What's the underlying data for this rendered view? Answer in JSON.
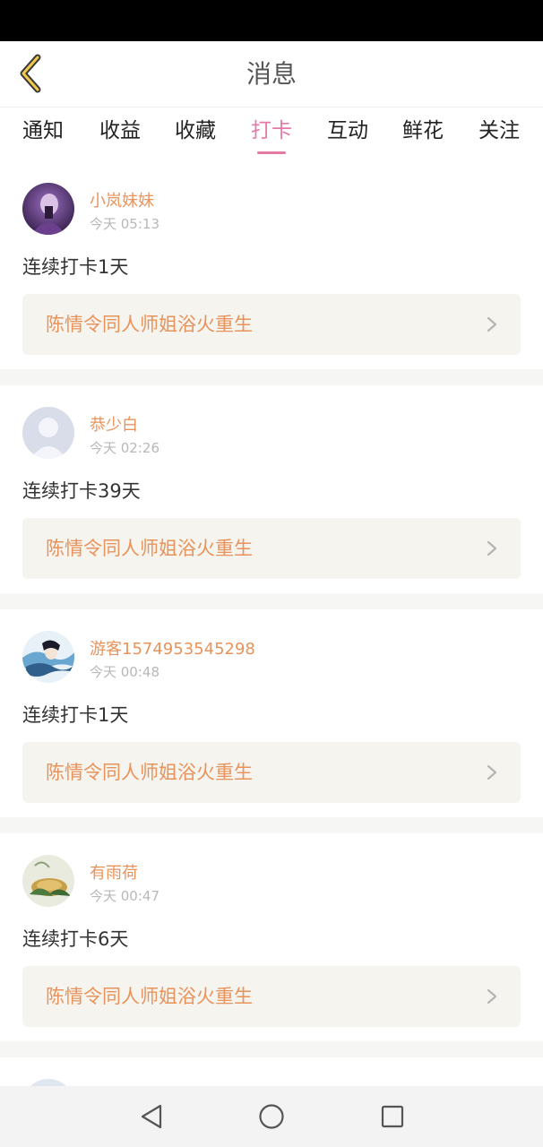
{
  "header": {
    "title": "消息",
    "back_icon": "chevron-left-icon"
  },
  "tabs": [
    {
      "label": "通知",
      "active": false
    },
    {
      "label": "收益",
      "active": false
    },
    {
      "label": "收藏",
      "active": false
    },
    {
      "label": "打卡",
      "active": true
    },
    {
      "label": "互动",
      "active": false
    },
    {
      "label": "鲜花",
      "active": false
    },
    {
      "label": "关注",
      "active": false
    }
  ],
  "colors": {
    "accent": "#e57aa6",
    "name": "#e8935b",
    "book_bg": "#f5f4ef"
  },
  "messages": [
    {
      "name": "小岚妹妹",
      "time": "今天 05:13",
      "checkin": "连续打卡1天",
      "book": "陈情令同人师姐浴火重生",
      "avatar": "purple-portrait"
    },
    {
      "name": "恭少白",
      "time": "今天 02:26",
      "checkin": "连续打卡39天",
      "book": "陈情令同人师姐浴火重生",
      "avatar": "default-user"
    },
    {
      "name": "游客1574953545298",
      "time": "今天 00:48",
      "checkin": "连续打卡1天",
      "book": "陈情令同人师姐浴火重生",
      "avatar": "blue-portrait"
    },
    {
      "name": "有雨荷",
      "time": "今天 00:47",
      "checkin": "连续打卡6天",
      "book": "陈情令同人师姐浴火重生",
      "avatar": "lotus-painting"
    }
  ],
  "nav": {
    "back": "triangle-back-icon",
    "home": "circle-home-icon",
    "recent": "square-recent-icon"
  }
}
